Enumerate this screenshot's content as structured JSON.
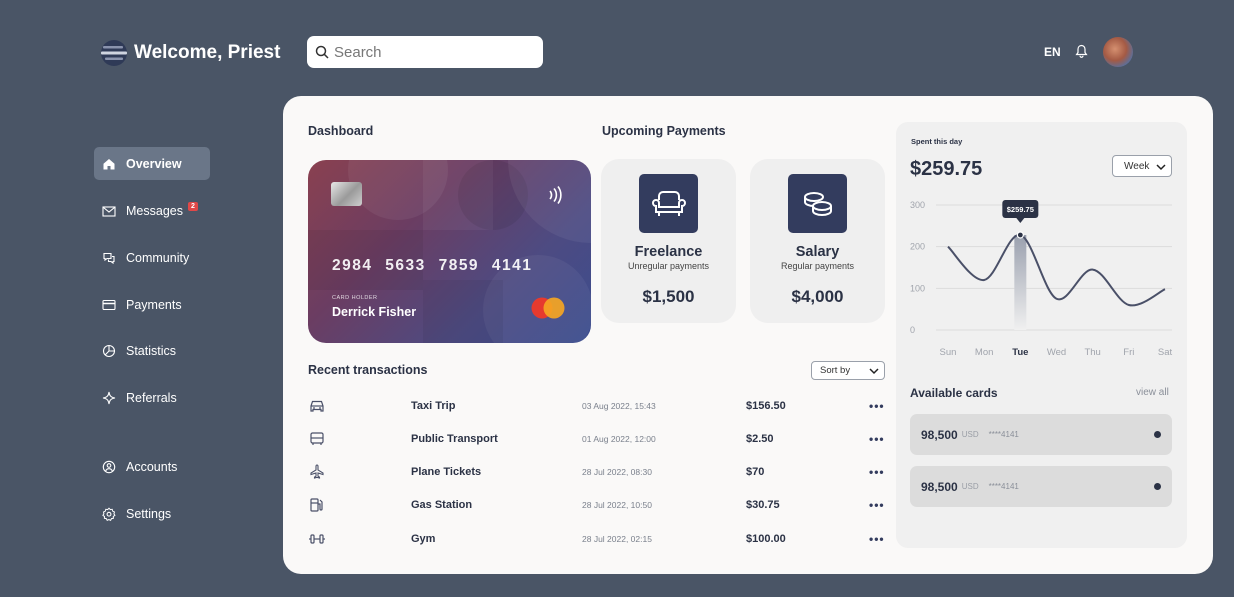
{
  "header": {
    "welcome": "Welcome, Priest",
    "search_placeholder": "Search",
    "language": "EN"
  },
  "sidebar": {
    "items": [
      {
        "label": "Overview",
        "icon": "home-icon",
        "active": true
      },
      {
        "label": "Messages",
        "icon": "mail-icon",
        "badge": "2"
      },
      {
        "label": "Community",
        "icon": "chat-icon"
      },
      {
        "label": "Payments",
        "icon": "card-icon"
      },
      {
        "label": "Statistics",
        "icon": "pie-chart-icon"
      },
      {
        "label": "Referrals",
        "icon": "sparkle-icon"
      },
      {
        "label": "Accounts",
        "icon": "user-circle-icon"
      },
      {
        "label": "Settings",
        "icon": "gear-icon"
      }
    ]
  },
  "dashboard": {
    "title": "Dashboard",
    "card": {
      "number": "2984 5633 7859 4141",
      "holder_label": "CARD HOLDER",
      "holder_name": "Derrick Fisher"
    }
  },
  "upcoming": {
    "title": "Upcoming Payments",
    "items": [
      {
        "name": "Freelance",
        "sub": "Unregular payments",
        "amount": "$1,500",
        "icon": "sofa-icon"
      },
      {
        "name": "Salary",
        "sub": "Regular payments",
        "amount": "$4,000",
        "icon": "coins-icon"
      }
    ]
  },
  "transactions": {
    "title": "Recent transactions",
    "sort_label": "Sort by",
    "rows": [
      {
        "name": "Taxi Trip",
        "date": "03 Aug 2022, 15:43",
        "amount": "$156.50",
        "icon": "car-icon"
      },
      {
        "name": "Public Transport",
        "date": "01 Aug 2022, 12:00",
        "amount": "$2.50",
        "icon": "bus-icon"
      },
      {
        "name": "Plane Tickets",
        "date": "28 Jul 2022, 08:30",
        "amount": "$70",
        "icon": "plane-icon"
      },
      {
        "name": "Gas Station",
        "date": "28 Jul 2022, 10:50",
        "amount": "$30.75",
        "icon": "fuel-icon"
      },
      {
        "name": "Gym",
        "date": "28 Jul 2022, 02:15",
        "amount": "$100.00",
        "icon": "dumbbell-icon"
      }
    ],
    "more_label": "•••"
  },
  "spending": {
    "label": "Spent this day",
    "amount": "$259.75",
    "period": "Week",
    "tooltip": "$259.75"
  },
  "chart_data": {
    "type": "line",
    "categories": [
      "Sun",
      "Mon",
      "Tue",
      "Wed",
      "Thu",
      "Fri",
      "Sat"
    ],
    "series": [
      {
        "values": [
          200,
          120,
          228,
          75,
          145,
          60,
          98
        ]
      }
    ],
    "highlight": {
      "category": "Tue",
      "value": 228
    },
    "ylim": [
      0,
      300
    ],
    "yticks": [
      0,
      100,
      200,
      300
    ],
    "grid": true,
    "colors": {
      "line": "#4a5068",
      "highlight": "#2b3245"
    }
  },
  "available_cards": {
    "title": "Available cards",
    "view_all": "view all",
    "cards": [
      {
        "value": "98,500",
        "currency": "USD",
        "number": "****4141"
      },
      {
        "value": "98,500",
        "currency": "USD",
        "number": "****4141"
      }
    ]
  }
}
